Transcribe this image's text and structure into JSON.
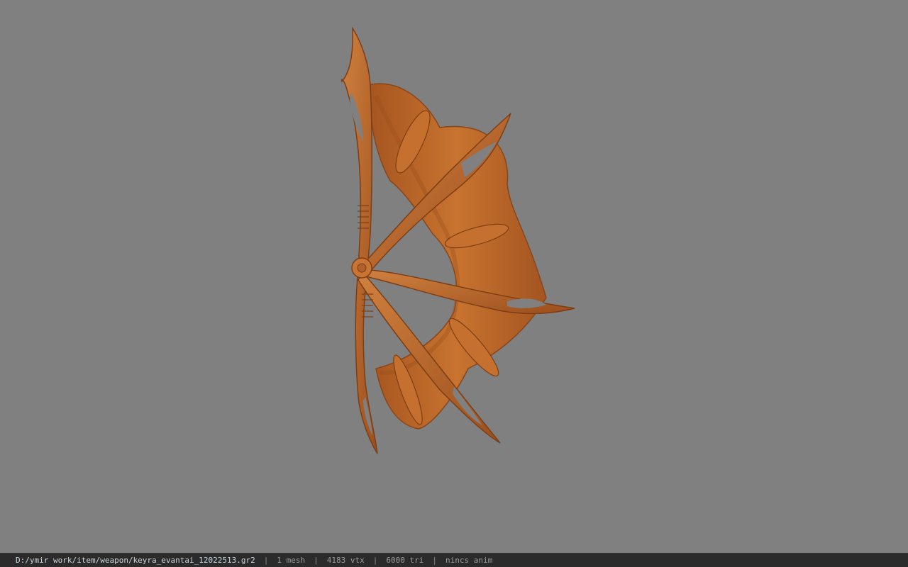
{
  "viewer": {
    "background_color": "#808080",
    "model_color": "#c16a2e",
    "model_shadow_color": "#8a4519",
    "model_highlight_color": "#d98a4a"
  },
  "status": {
    "file_path": "D:/ymir work/item/weapon/keyra_evantai_12022513.gr2",
    "mesh_count": "1 mesh",
    "vertex_count": "4183 vtx",
    "triangle_count": "6000 tri",
    "anim": "nincs anim",
    "separator": "|"
  }
}
